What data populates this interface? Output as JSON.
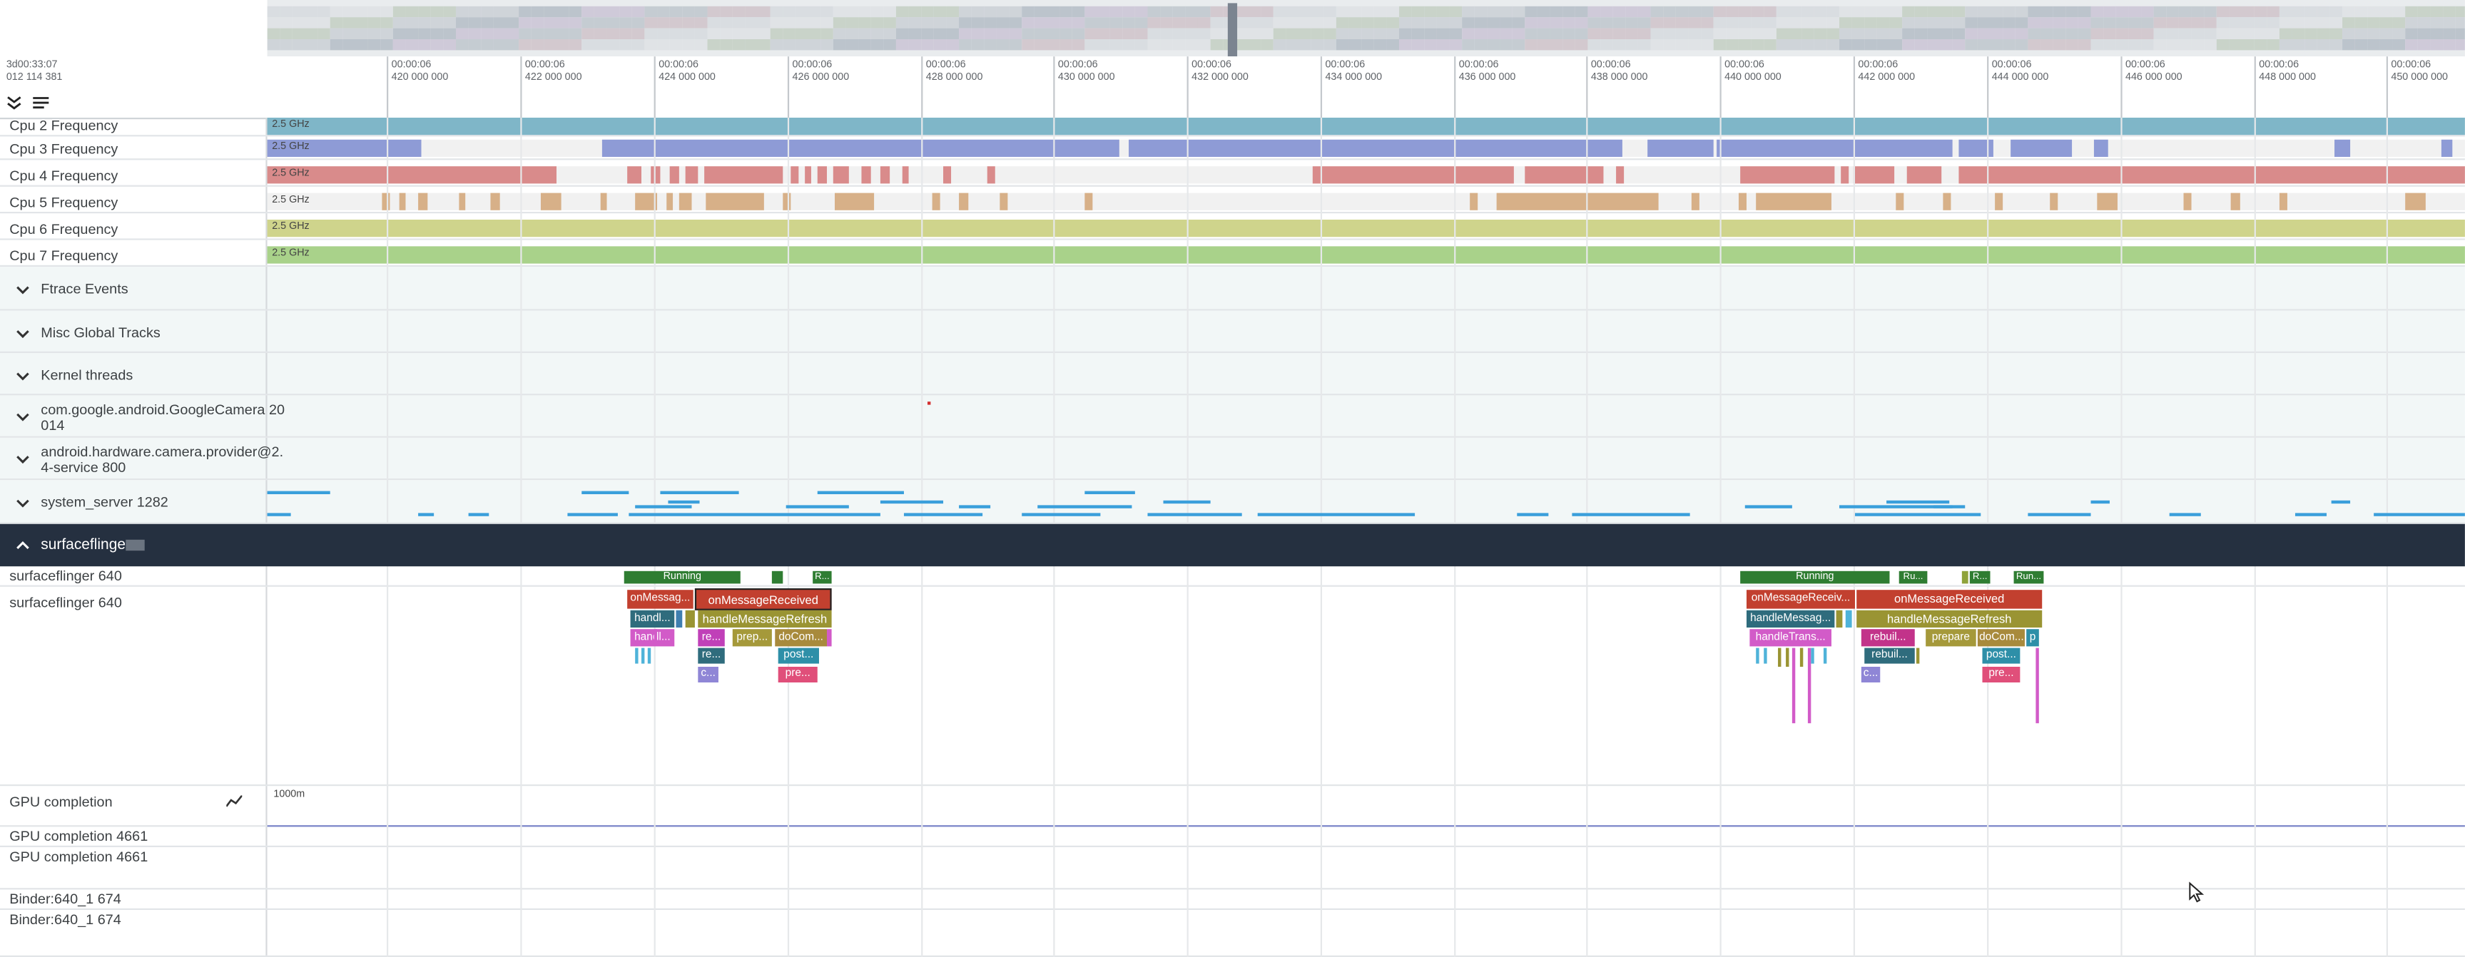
{
  "header": {
    "time_line1": "3d00:33:07",
    "time_line2": "012 114 381",
    "ticks": [
      {
        "top": "00:00:06",
        "bottom": "420 000 000"
      },
      {
        "top": "00:00:06",
        "bottom": "422 000 000"
      },
      {
        "top": "00:00:06",
        "bottom": "424 000 000"
      },
      {
        "top": "00:00:06",
        "bottom": "426 000 000"
      },
      {
        "top": "00:00:06",
        "bottom": "428 000 000"
      },
      {
        "top": "00:00:06",
        "bottom": "430 000 000"
      },
      {
        "top": "00:00:06",
        "bottom": "432 000 000"
      },
      {
        "top": "00:00:06",
        "bottom": "434 000 000"
      },
      {
        "top": "00:00:06",
        "bottom": "436 000 000"
      },
      {
        "top": "00:00:06",
        "bottom": "438 000 000"
      },
      {
        "top": "00:00:06",
        "bottom": "440 000 000"
      },
      {
        "top": "00:00:06",
        "bottom": "442 000 000"
      },
      {
        "top": "00:00:06",
        "bottom": "444 000 000"
      },
      {
        "top": "00:00:06",
        "bottom": "446 000 000"
      },
      {
        "top": "00:00:06",
        "bottom": "448 000 000"
      },
      {
        "top": "00:00:06",
        "bottom": "450 000 000"
      }
    ]
  },
  "freq_tracks": [
    {
      "name": "Cpu 2 Frequency",
      "value_label": "2.5 GHz",
      "color": "#7fb6c8"
    },
    {
      "name": "Cpu 3 Frequency",
      "value_label": "2.5 GHz",
      "color": "#8e9bd6"
    },
    {
      "name": "Cpu 4 Frequency",
      "value_label": "2.5 GHz",
      "color": "#d98b8b"
    },
    {
      "name": "Cpu 5 Frequency",
      "value_label": "2.5 GHz",
      "color": "#d7b088"
    },
    {
      "name": "Cpu 6 Frequency",
      "value_label": "2.5 GHz",
      "color": "#cfd48c"
    },
    {
      "name": "Cpu 7 Frequency",
      "value_label": "2.5 GHz",
      "color": "#a9d28a"
    }
  ],
  "groups": [
    {
      "name": "Ftrace Events"
    },
    {
      "name": "Misc Global Tracks"
    },
    {
      "name": "Kernel threads"
    },
    {
      "name": "com.google.android.GoogleCamera 20",
      "name2": "014"
    },
    {
      "name": "android.hardware.camera.provider@2.",
      "name2": "4-service 800"
    },
    {
      "name": "system_server 1282"
    }
  ],
  "surfaceflinger": {
    "group_name": "surfaceflinger",
    "thread_state_label": "surfaceflinger 640",
    "slices_label": "surfaceflinger 640",
    "running": [
      "Running",
      "R...",
      "Running",
      "Ru...",
      "R...",
      "Run..."
    ],
    "frame1": [
      "onMessag...",
      "onMessageReceived",
      "handl...",
      "handleMessageRefresh",
      "handl...",
      "re...",
      "prep...",
      "doCom...",
      "re...",
      "post...",
      "c...",
      "pre..."
    ],
    "frame2": [
      "onMessageReceiv...",
      "onMessageReceived",
      "handleMessag...",
      "handleMessageRefresh",
      "handleTrans...",
      "rebuil...",
      "prepare",
      "doCom...",
      "p",
      "rebuil...",
      "post...",
      "c...",
      "pre..."
    ]
  },
  "bottom_tracks": [
    {
      "name": "GPU completion",
      "value_label": "1000m"
    },
    {
      "name": "GPU completion 4661"
    },
    {
      "name": "GPU completion 4661"
    },
    {
      "name": "Binder:640_1 674"
    },
    {
      "name": "Binder:640_1 674"
    }
  ],
  "colors": {
    "running": "#2f7d32",
    "onMessageReceived": "#c2402f",
    "handleMessageRefresh": "#9a9433",
    "handleTransaction": "#d25bc8",
    "rebuild": "#2f6c7d",
    "prepare": "#a5993a",
    "doComposition": "#a88a3c",
    "post": "#2e8fa8",
    "composite": "#8f86d6",
    "present": "#e04f7a",
    "cpu_bar": "#3a9fdb",
    "header_dark": "#253040"
  }
}
